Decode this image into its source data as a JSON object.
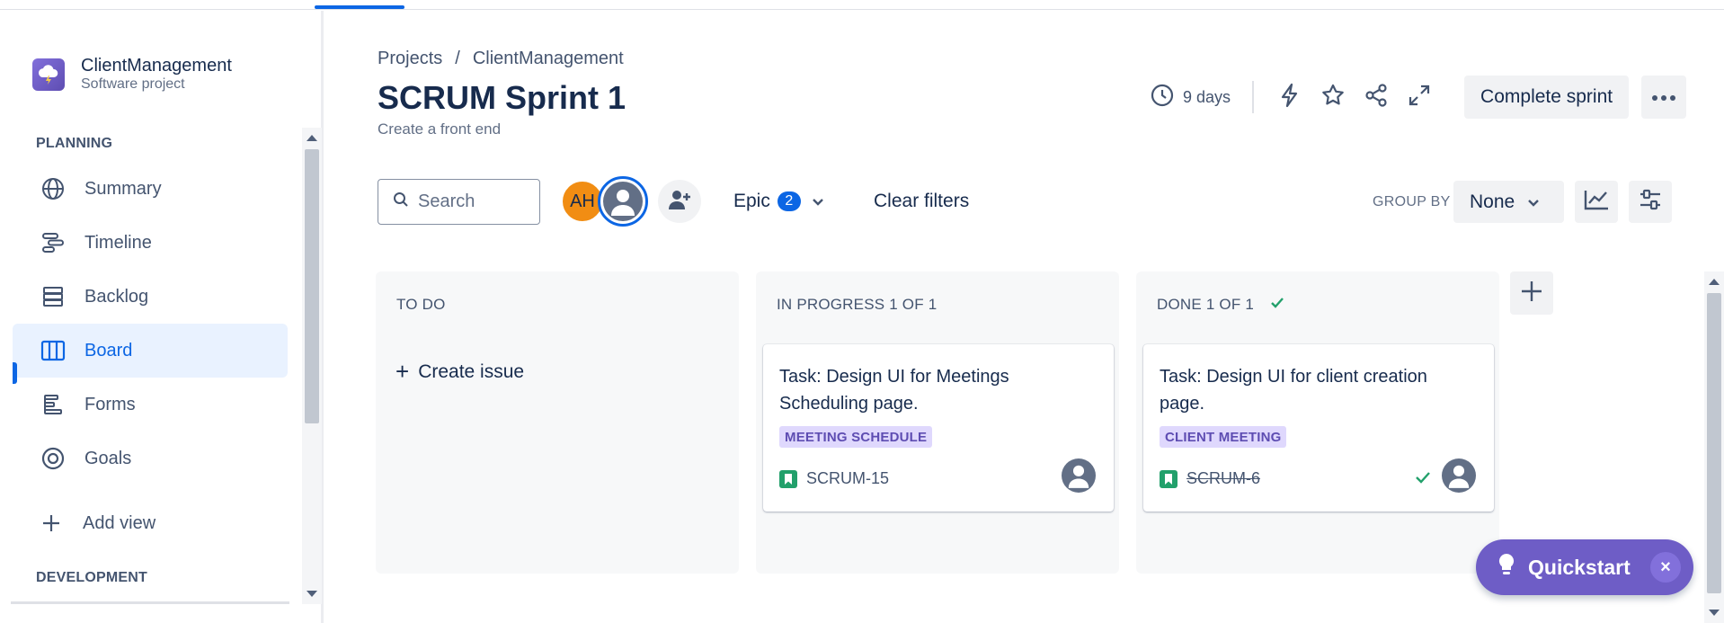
{
  "sidebar": {
    "project_name": "ClientManagement",
    "project_type": "Software project",
    "planning_title": "PLANNING",
    "development_title": "DEVELOPMENT",
    "items": [
      {
        "label": "Summary",
        "icon": "globe-icon"
      },
      {
        "label": "Timeline",
        "icon": "timeline-icon"
      },
      {
        "label": "Backlog",
        "icon": "backlog-icon"
      },
      {
        "label": "Board",
        "icon": "board-icon",
        "selected": true
      },
      {
        "label": "Forms",
        "icon": "forms-icon"
      },
      {
        "label": "Goals",
        "icon": "goals-icon"
      }
    ],
    "add_view": "Add view"
  },
  "header": {
    "breadcrumb": [
      "Projects",
      "/",
      "ClientManagement"
    ],
    "title": "SCRUM Sprint 1",
    "goal": "Create a front end",
    "days_remaining": "9 days",
    "complete_sprint": "Complete sprint"
  },
  "filters": {
    "search_placeholder": "Search",
    "avatar_initials": "AH",
    "epic_label": "Epic",
    "epic_count": "2",
    "clear_filters": "Clear filters",
    "group_by_label": "GROUP BY",
    "group_by_value": "None"
  },
  "board": {
    "columns": [
      {
        "title": "TO DO",
        "create_issue": "Create issue"
      },
      {
        "title": "IN PROGRESS 1 OF 1",
        "card": {
          "summary": "Task: Design UI for Meetings Scheduling page.",
          "label": "MEETING SCHEDULE",
          "key": "SCRUM-15"
        }
      },
      {
        "title": "DONE 1 OF 1",
        "card": {
          "summary": "Task: Design UI for client creation page.",
          "label": "CLIENT MEETING",
          "key": "SCRUM-6"
        }
      }
    ]
  },
  "quickstart": {
    "label": "Quickstart"
  },
  "colors": {
    "accent": "#0c66e4",
    "done": "#22a06b",
    "label_bg": "#dfd8fd",
    "label_text": "#5e4db2",
    "quickstart": "#6e5dc6"
  }
}
